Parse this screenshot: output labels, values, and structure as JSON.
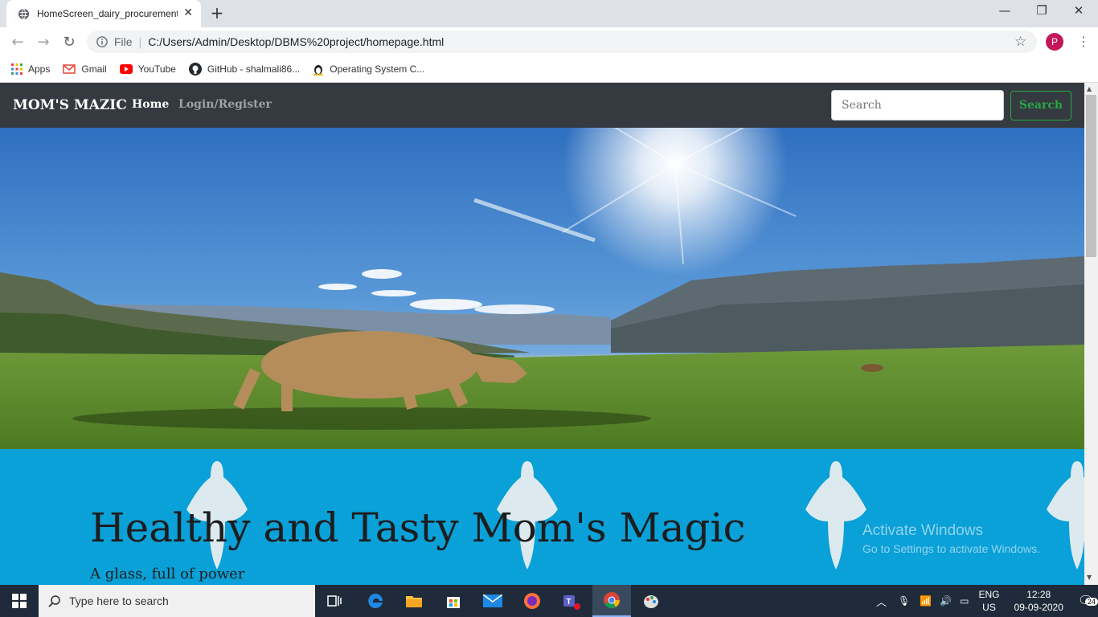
{
  "browser": {
    "tab_title": "HomeScreen_dairy_procurement",
    "url_prefix": "File",
    "url": "C:/Users/Admin/Desktop/DBMS%20project/homepage.html",
    "profile_initial": "P",
    "bookmarks": [
      "Apps",
      "Gmail",
      "YouTube",
      "GitHub - shalmali86...",
      "Operating System C..."
    ]
  },
  "navbar": {
    "brand": "MOM'S MAZIC",
    "home": "Home",
    "login": "Login/Register",
    "search_placeholder": "Search",
    "search_button": "Search"
  },
  "jumbotron": {
    "headline": "Healthy and Tasty Mom's Magic",
    "subline": "A glass, full of power"
  },
  "watermark": {
    "line1": "Activate Windows",
    "line2": "Go to Settings to activate Windows."
  },
  "taskbar": {
    "search_placeholder": "Type here to search",
    "lang": "ENG",
    "region": "US",
    "time": "12:28",
    "date": "09-09-2020",
    "notifications": "24"
  }
}
